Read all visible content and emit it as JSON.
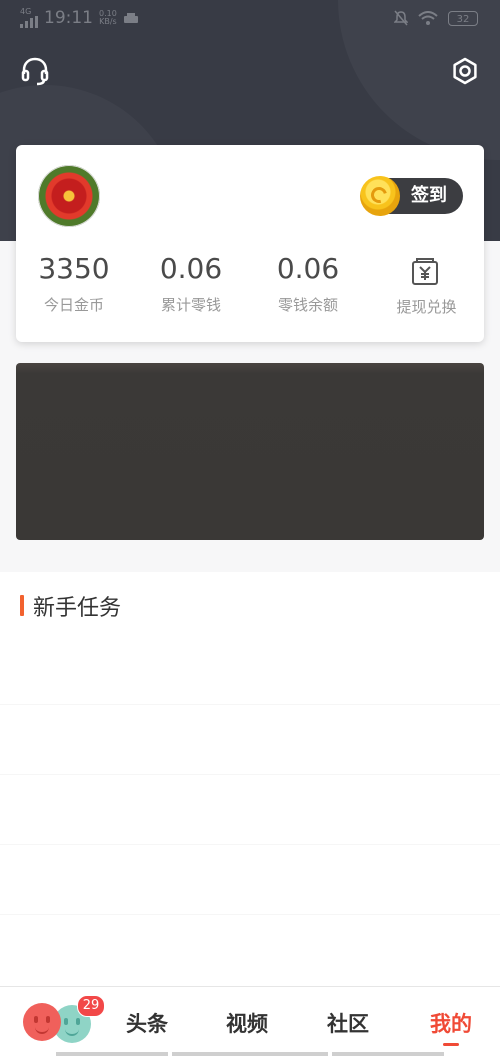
{
  "status_bar": {
    "network": "4G",
    "time": "19:11",
    "speed_value": "0.10",
    "speed_unit": "KB/s",
    "battery": "32"
  },
  "header": {
    "support_icon": "headset-icon",
    "settings_icon": "settings-icon"
  },
  "profile": {
    "avatar_icon": "flower-avatar",
    "checkin_label": "签到",
    "stats": [
      {
        "value": "3350",
        "label": "今日金币"
      },
      {
        "value": "0.06",
        "label": "累计零钱"
      },
      {
        "value": "0.06",
        "label": "零钱余额"
      }
    ],
    "exchange_label": "提现兑换",
    "exchange_icon": "wallet-yen-icon"
  },
  "section": {
    "title": "新手任务"
  },
  "tabbar": {
    "badge": "29",
    "tabs": [
      "头条",
      "视频",
      "社区",
      "我的"
    ],
    "active_tab": "我的"
  },
  "colors": {
    "header_bg": "#383b45",
    "accent": "#f04a36",
    "section_bar": "#f2622f"
  }
}
